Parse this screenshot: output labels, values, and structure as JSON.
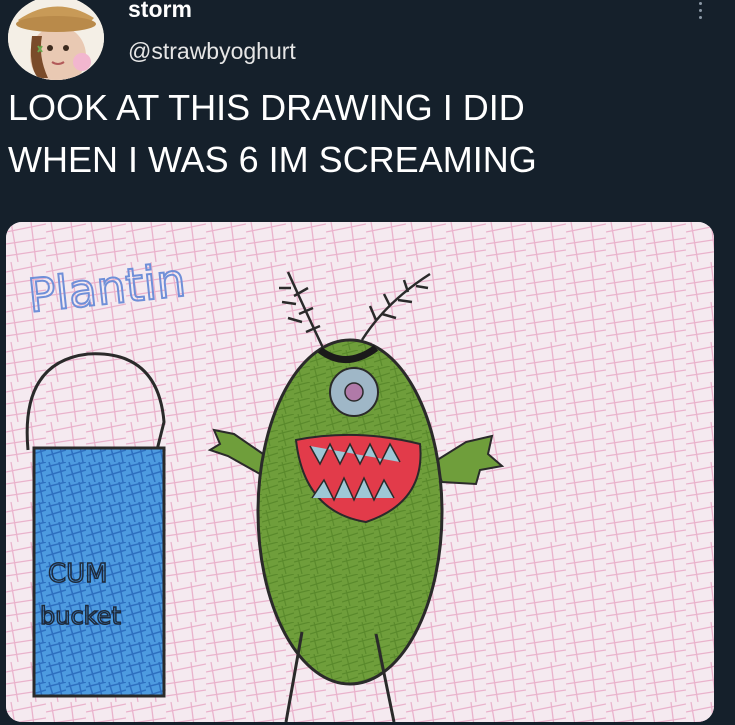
{
  "user": {
    "display_name": "storm",
    "handle": "@strawbyoghurt",
    "avatar_icon": "avatar-cowgirl-icon"
  },
  "tweet": {
    "text_lines": [
      "LOOK AT THIS DRAWING I DID",
      "WHEN I WAS 6 IM SCREAMING"
    ]
  },
  "drawing": {
    "title_text": "Plantin",
    "bucket_label_line1": "CUM",
    "bucket_label_line2": "bucket"
  },
  "colors": {
    "background": "#15202b",
    "text": "#ffffff",
    "muted": "#8b98a5",
    "paper": "#f3e7ee",
    "crayon_pink": "#e7a4c3",
    "plankton_green": "#6f9e3b",
    "bucket_blue": "#3a8ad8",
    "title_blue": "#6f8fd8",
    "mouth_red": "#e23b4a"
  }
}
